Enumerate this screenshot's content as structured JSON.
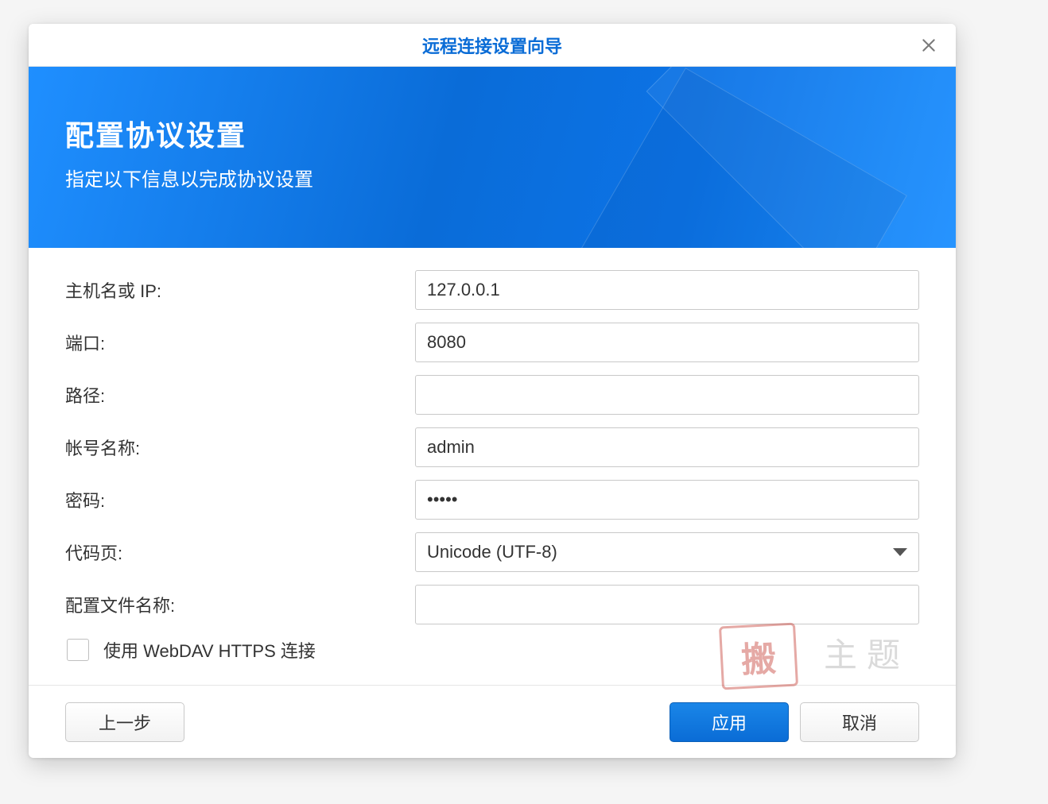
{
  "title": "远程连接设置向导",
  "banner": {
    "heading": "配置协议设置",
    "subheading": "指定以下信息以完成协议设置"
  },
  "form": {
    "hostname": {
      "label": "主机名或 IP:",
      "value": "127.0.0.1"
    },
    "port": {
      "label": "端口:",
      "value": "8080"
    },
    "path": {
      "label": "路径:",
      "value": ""
    },
    "account": {
      "label": "帐号名称:",
      "value": "admin"
    },
    "password": {
      "label": "密码:",
      "value": "•••••"
    },
    "codepage": {
      "label": "代码页:",
      "value": "Unicode (UTF-8)"
    },
    "profile": {
      "label": "配置文件名称:",
      "value": ""
    },
    "https_checkbox": {
      "label": "使用 WebDAV HTTPS 连接",
      "checked": false
    }
  },
  "buttons": {
    "back": "上一步",
    "apply": "应用",
    "cancel": "取消"
  },
  "watermark": {
    "text": "主题",
    "seal": "搬"
  }
}
